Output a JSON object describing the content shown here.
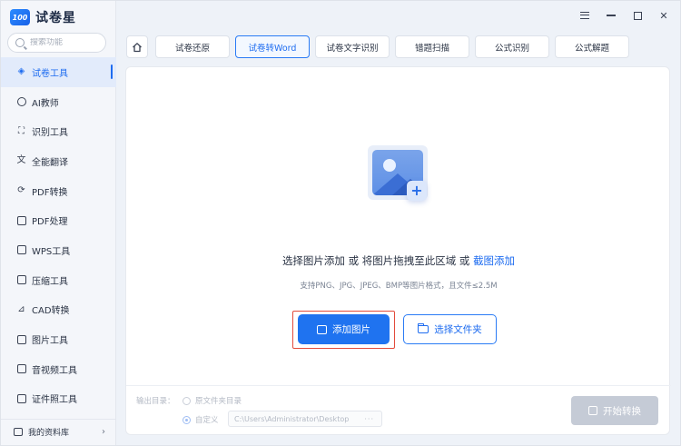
{
  "app": {
    "badge": "100",
    "name": "试卷星"
  },
  "search": {
    "placeholder": "搜索功能"
  },
  "sidebar": {
    "items": [
      {
        "label": "试卷工具",
        "active": true
      },
      {
        "label": "AI教师"
      },
      {
        "label": "识别工具"
      },
      {
        "label": "全能翻译"
      },
      {
        "label": "PDF转换"
      },
      {
        "label": "PDF处理"
      },
      {
        "label": "WPS工具"
      },
      {
        "label": "压缩工具"
      },
      {
        "label": "CAD转换"
      },
      {
        "label": "图片工具"
      },
      {
        "label": "音视频工具"
      },
      {
        "label": "证件照工具"
      }
    ],
    "bottom": {
      "label": "我的资料库",
      "arrow": "›"
    }
  },
  "tabs": [
    {
      "label": "试卷还原"
    },
    {
      "label": "试卷转Word",
      "active": true
    },
    {
      "label": "试卷文字识别"
    },
    {
      "label": "错题扫描"
    },
    {
      "label": "公式识别"
    },
    {
      "label": "公式解题"
    }
  ],
  "upload": {
    "hint_part1": "选择图片添加 或 将图片拖拽至此区域 或 ",
    "hint_link": "截图添加",
    "formats": "支持PNG、JPG、JPEG、BMP等图片格式，且文件≤2.5M",
    "add_button": "添加图片",
    "folder_button": "选择文件夹"
  },
  "output": {
    "label": "输出目录：",
    "option_original": "原文件夹目录",
    "option_custom": "自定义",
    "path": "C:\\Users\\Administrator\\Desktop",
    "browse": "···",
    "start_button": "开始转换"
  },
  "colors": {
    "accent": "#1f73f0",
    "highlight": "#e24b3b",
    "disabled": "#c5cbd6"
  }
}
